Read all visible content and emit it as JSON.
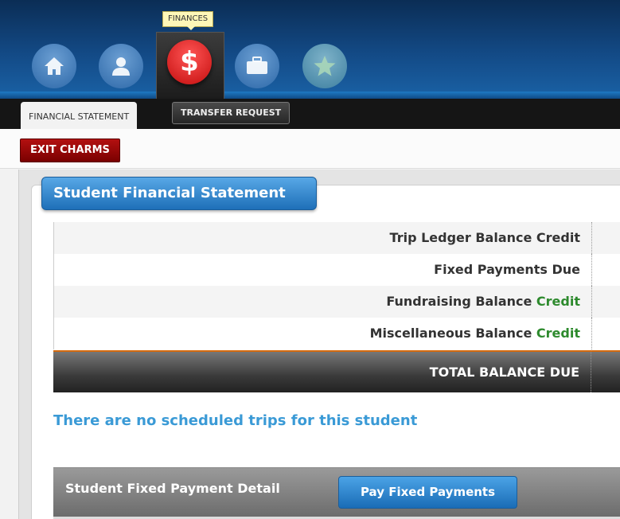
{
  "nav": {
    "tooltip": "FINANCES",
    "icons": [
      "home-icon",
      "person-icon",
      "dollar-icon",
      "briefcase-icon",
      "star-icon"
    ],
    "active_symbol": "$"
  },
  "tabs": {
    "active": "FINANCIAL STATEMENT",
    "inactive": "TRANSFER REQUEST"
  },
  "exit_button": "EXIT CHARMS",
  "statement": {
    "title": "Student Financial Statement",
    "rows": [
      {
        "label": "Trip Ledger Balance Credit"
      },
      {
        "label": "Fixed Payments Due"
      },
      {
        "label": "Fundraising Balance",
        "status": "Credit"
      },
      {
        "label": "Miscellaneous Balance",
        "status": "Credit"
      }
    ],
    "total_label": "TOTAL BALANCE DUE"
  },
  "no_trips_message": "There are no scheduled trips for this student",
  "fixed_payment": {
    "title": "Student Fixed Payment Detail",
    "pay_button": "Pay Fixed Payments"
  },
  "colors": {
    "credit": "#2d8a2d",
    "message": "#3a9ad6",
    "exit": "#9b0a0a",
    "accent_blue": "#1e6fb8"
  }
}
